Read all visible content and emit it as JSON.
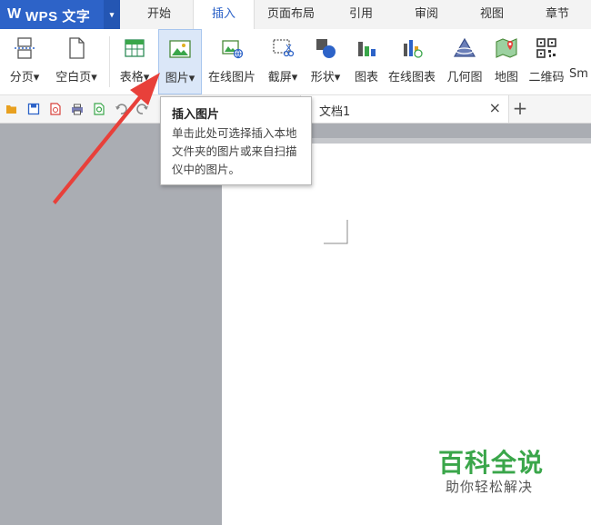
{
  "app": {
    "logo": "W",
    "name": "WPS 文字",
    "menu_arrow": "▾"
  },
  "tabs": [
    "开始",
    "插入",
    "页面布局",
    "引用",
    "审阅",
    "视图",
    "章节"
  ],
  "active_tab": "插入",
  "ribbon": [
    {
      "label": "分页▾",
      "icon": "page-break-icon"
    },
    {
      "label": "空白页▾",
      "icon": "blank-page-icon"
    },
    {
      "label": "表格▾",
      "icon": "table-icon"
    },
    {
      "label": "图片▾",
      "icon": "picture-icon"
    },
    {
      "label": "在线图片",
      "icon": "online-picture-icon"
    },
    {
      "label": "截屏▾",
      "icon": "screenshot-icon"
    },
    {
      "label": "形状▾",
      "icon": "shapes-icon"
    },
    {
      "label": "图表",
      "icon": "chart-icon"
    },
    {
      "label": "在线图表",
      "icon": "online-chart-icon"
    },
    {
      "label": "几何图",
      "icon": "geometry-icon"
    },
    {
      "label": "地图",
      "icon": "map-icon"
    },
    {
      "label": "二维码",
      "icon": "qrcode-icon"
    },
    {
      "label": "Sm",
      "icon": "smartart-icon"
    }
  ],
  "document_tab": {
    "title": "文档1",
    "close": "×",
    "add": "+"
  },
  "tooltip": {
    "title": "插入图片",
    "body": "单击此处可选择插入本地文件夹的图片或来自扫描仪中的图片。"
  },
  "watermark": {
    "title": "百科全说",
    "subtitle": "助你轻松解决"
  },
  "colors": {
    "brand": "#2d63c8",
    "arrow": "#e8403a",
    "watermark": "#3aa64a"
  }
}
